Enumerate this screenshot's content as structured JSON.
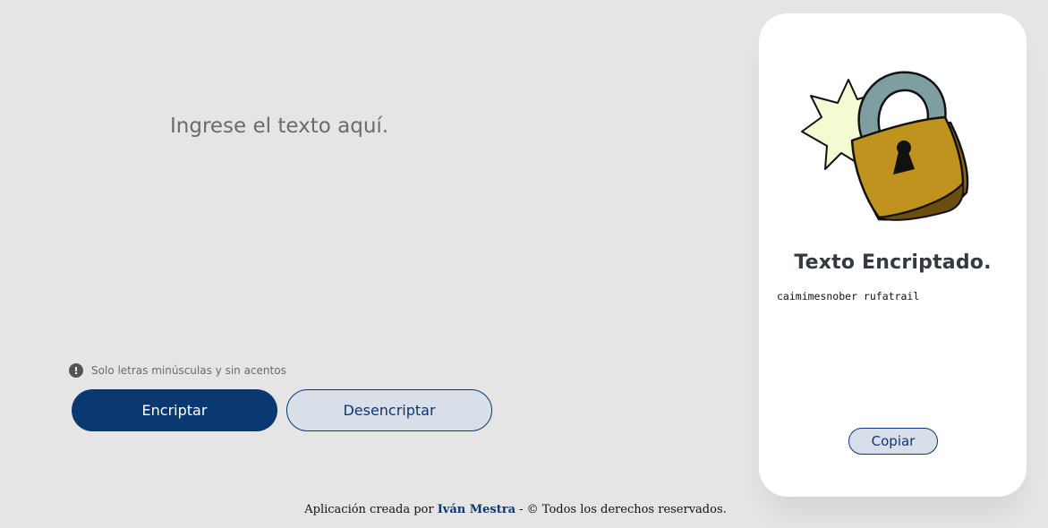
{
  "input": {
    "placeholder": "Ingrese el texto aquí.",
    "value": ""
  },
  "hint": {
    "icon": "exclamation-circle-icon",
    "text": "Solo letras minúsculas y sin acentos"
  },
  "buttons": {
    "encrypt_label": "Encriptar",
    "decrypt_label": "Desencriptar"
  },
  "result_panel": {
    "image": "padlock-illustration",
    "title": "Texto Encriptado.",
    "output_text": "caimimesnober rufatrail",
    "copy_label": "Copiar"
  },
  "footer": {
    "prefix": "Aplicación creada por ",
    "author": "Iván Mestra",
    "suffix": " - © Todos los derechos reservados."
  },
  "colors": {
    "background": "#e5e5e5",
    "primary": "#0a3871",
    "secondary_bg": "#d8dfe8",
    "panel_bg": "#ffffff",
    "title_text": "#343a40"
  }
}
